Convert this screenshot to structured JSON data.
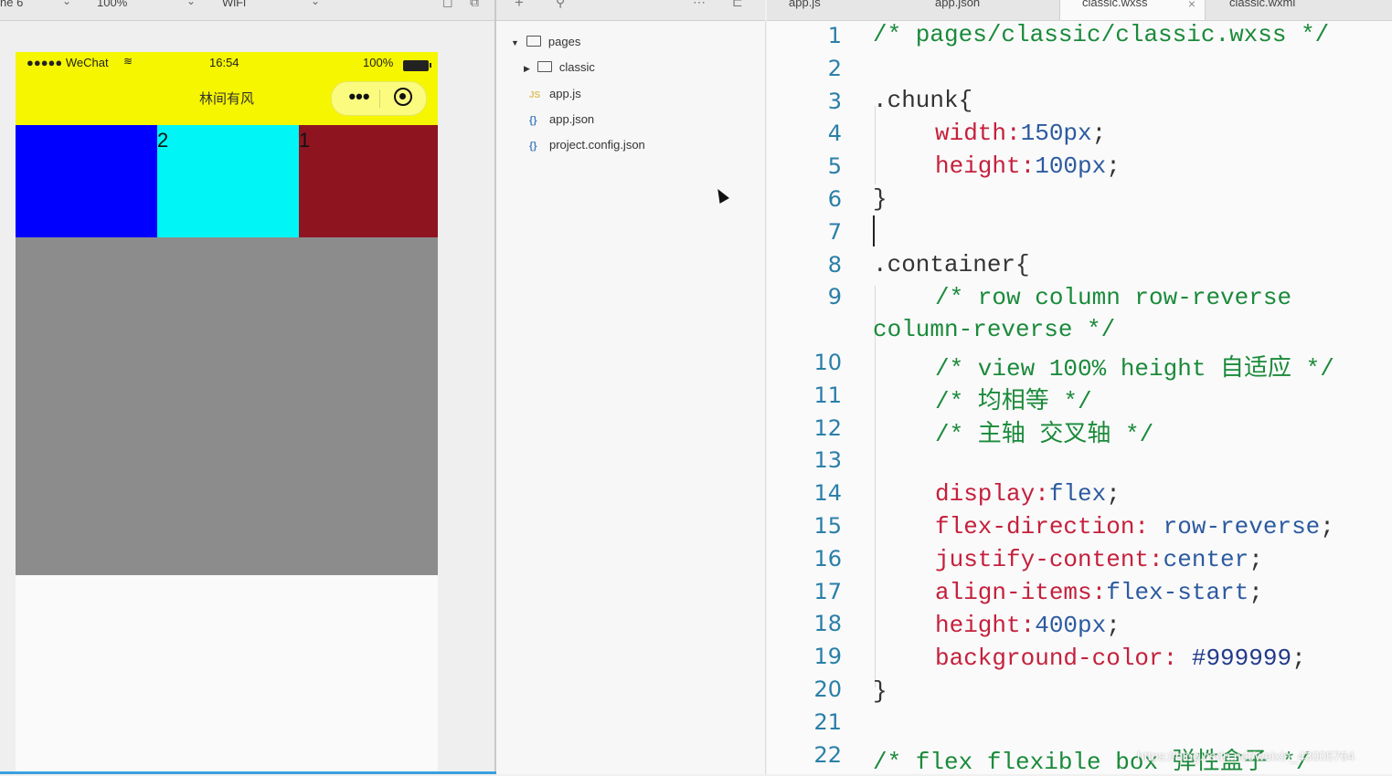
{
  "toolbar": {
    "device": "ne 6",
    "zoom": "100%",
    "network": "WiFi",
    "tabs": [
      {
        "label": "app.js",
        "active": false
      },
      {
        "label": "app.json",
        "active": false
      },
      {
        "label": "classic.wxss",
        "active": true
      },
      {
        "label": "classic.wxml",
        "active": false
      }
    ]
  },
  "phone": {
    "status_left": "●●●●● WeChat",
    "time": "16:54",
    "battery": "100%",
    "nav_title": "林间有风",
    "nav_bg": "#f6f600",
    "chunks": [
      {
        "label": "",
        "color": "#0000ff"
      },
      {
        "label": "2",
        "color": "#00f6f6"
      },
      {
        "label": "1",
        "color": "#8e1520"
      }
    ],
    "container_bg": "#8c8c8c"
  },
  "tree": {
    "items": [
      {
        "label": "pages",
        "type": "folder",
        "expanded": true
      },
      {
        "label": "classic",
        "type": "folder",
        "expanded": false
      },
      {
        "label": "app.js",
        "type": "js"
      },
      {
        "label": "app.json",
        "type": "json"
      },
      {
        "label": "project.config.json",
        "type": "json"
      }
    ]
  },
  "editor": {
    "line_numbers": [
      "1",
      "2",
      "3",
      "4",
      "5",
      "6",
      "7",
      "8",
      "9",
      "",
      "10",
      "11",
      "12",
      "13",
      "14",
      "15",
      "16",
      "17",
      "18",
      "19",
      "20",
      "21",
      "22"
    ],
    "lines": {
      "l1": "/* pages/classic/classic.wxss */",
      "l3": ".chunk{",
      "l4p": "width:",
      "l4v": "150px",
      "l4e": ";",
      "l5p": "height:",
      "l5v": "100px",
      "l5e": ";",
      "l6": "}",
      "l8": ".container{",
      "l9a": "/* row column row-reverse",
      "l9b": "column-reverse */",
      "l10": "/* view 100% height 自适应 */",
      "l11": "/* 均相等 */",
      "l12": "/* 主轴 交叉轴 */",
      "l14p": "display:",
      "l14v": "flex",
      "l14e": ";",
      "l15p": "flex-direction:",
      "l15v": " row-reverse",
      "l15e": ";",
      "l16p": "justify-content:",
      "l16v": "center",
      "l16e": ";",
      "l17p": "align-items:",
      "l17v": "flex-start",
      "l17e": ";",
      "l18p": "height:",
      "l18v": "400px",
      "l18e": ";",
      "l19p": "background-color:",
      "l19v": " #999999",
      "l19e": ";",
      "l20": "}",
      "l22": "/* flex flexible box 弹性盒子 */"
    },
    "watermark": "https://blog.csdn.net/weixin_43005764"
  }
}
